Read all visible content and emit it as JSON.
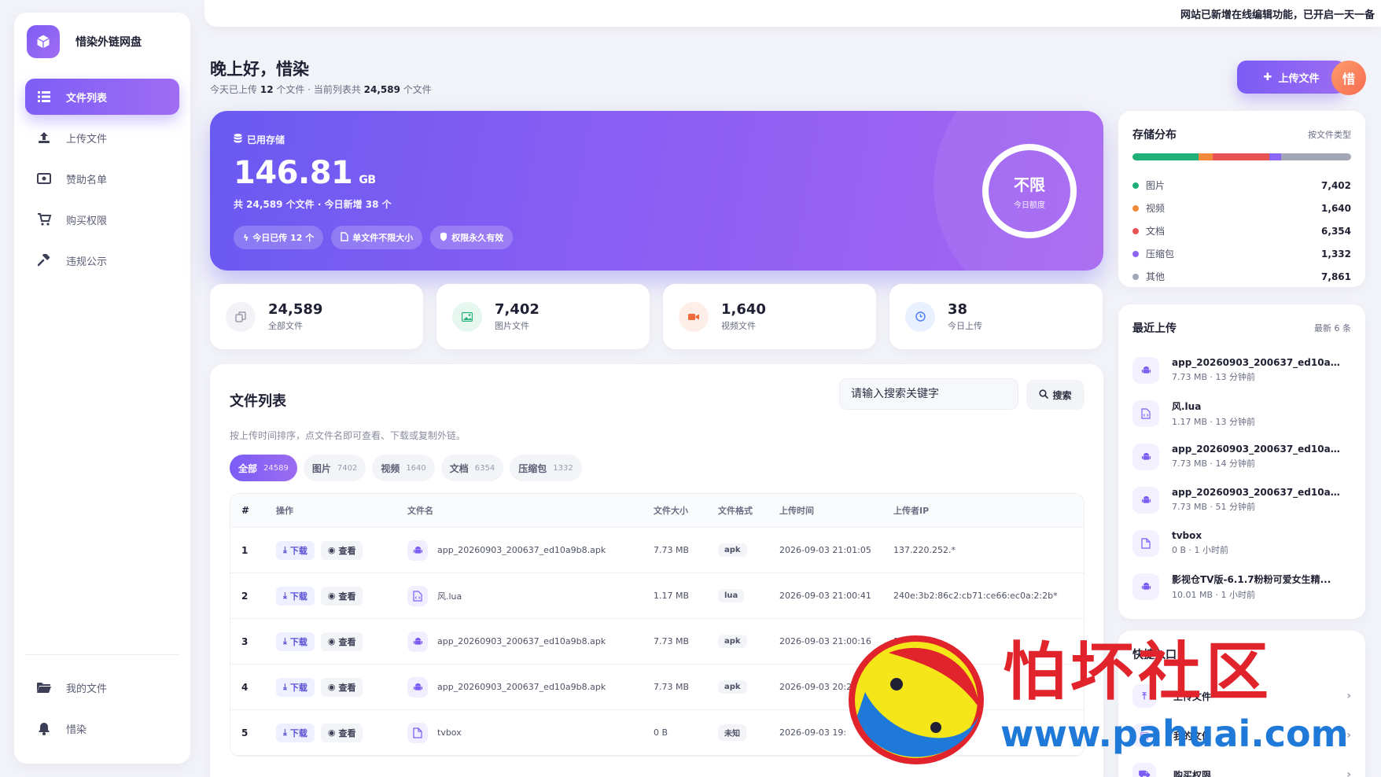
{
  "brand": {
    "name": "惜染外链网盘"
  },
  "sidebar": {
    "items": [
      {
        "label": "文件列表",
        "icon": "list-icon",
        "active": true
      },
      {
        "label": "上传文件",
        "icon": "upload-icon"
      },
      {
        "label": "赞助名单",
        "icon": "money-icon"
      },
      {
        "label": "购买权限",
        "icon": "cart-icon"
      },
      {
        "label": "违规公示",
        "icon": "gavel-icon"
      }
    ],
    "bottom_items": [
      {
        "label": "我的文件",
        "icon": "folder-icon"
      },
      {
        "label": "惜染",
        "icon": "bell-icon"
      }
    ]
  },
  "notice": {
    "text": "网站已新增在线编辑功能，已开启一天一备"
  },
  "greeting": {
    "title": "晚上好，惜染",
    "sub_prefix": "今天已上传",
    "today_count": "12",
    "sub_middle": "个文件 · 当前列表共",
    "list_count": "24,589",
    "sub_suffix": "个文件"
  },
  "header": {
    "upload_label": "上传文件",
    "avatar_text": "惜"
  },
  "storage": {
    "label": "已用存储",
    "value": "146.81",
    "unit": "GB",
    "sub": "共 24,589 个文件 · 今日新增 38 个",
    "pills": [
      "今日已传 12 个",
      "单文件不限大小",
      "权限永久有效"
    ],
    "quota_big": "不限",
    "quota_small": "今日额度"
  },
  "stats": [
    {
      "value": "24,589",
      "label": "全部文件",
      "icon": "copy-icon",
      "bg": "#f2f2f7",
      "fg": "#9a9cae"
    },
    {
      "value": "7,402",
      "label": "图片文件",
      "icon": "image-icon",
      "bg": "#e6f7ef",
      "fg": "#22b07d"
    },
    {
      "value": "1,640",
      "label": "视频文件",
      "icon": "video-icon",
      "bg": "#fdeee8",
      "fg": "#f26b3a"
    },
    {
      "value": "38",
      "label": "今日上传",
      "icon": "clock-icon",
      "bg": "#e9f0ff",
      "fg": "#4b7bf5"
    }
  ],
  "file_list": {
    "title": "文件列表",
    "search_placeholder": "请输入搜索关键字",
    "search_label": "搜索",
    "hint": "按上传时间排序，点文件名即可查看、下载或复制外链。",
    "tabs": [
      {
        "label": "全部",
        "count": "24589",
        "active": true
      },
      {
        "label": "图片",
        "count": "7402"
      },
      {
        "label": "视频",
        "count": "1640"
      },
      {
        "label": "文档",
        "count": "6354"
      },
      {
        "label": "压缩包",
        "count": "1332"
      }
    ],
    "columns": [
      "#",
      "操作",
      "文件名",
      "文件大小",
      "文件格式",
      "上传时间",
      "上传者IP"
    ],
    "download_label": "下载",
    "view_label": "查看",
    "rows": [
      {
        "no": "1",
        "name": "app_20260903_200637_ed10a9b8.apk",
        "icon": "android-icon",
        "size": "7.73 MB",
        "fmt": "apk",
        "time": "2026-09-03 21:01:05",
        "ip": "137.220.252.*"
      },
      {
        "no": "2",
        "name": "风.lua",
        "icon": "code-file-icon",
        "size": "1.17 MB",
        "fmt": "lua",
        "time": "2026-09-03 21:00:41",
        "ip": "240e:3b2:86c2:cb71:ce66:ec0a:2:2b*"
      },
      {
        "no": "3",
        "name": "app_20260903_200637_ed10a9b8.apk",
        "icon": "android-icon",
        "size": "7.73 MB",
        "fmt": "apk",
        "time": "2026-09-03 21:00:16",
        "ip": "137"
      },
      {
        "no": "4",
        "name": "app_20260903_200637_ed10a9b8.apk",
        "icon": "android-icon",
        "size": "7.73 MB",
        "fmt": "apk",
        "time": "2026-09-03 20:2",
        "ip": ""
      },
      {
        "no": "5",
        "name": "tvbox",
        "icon": "file-icon",
        "size": "0 B",
        "fmt": "未知",
        "time": "2026-09-03 19:",
        "ip": ""
      }
    ]
  },
  "distribution": {
    "title": "存储分布",
    "meta": "按文件类型",
    "items": [
      {
        "label": "图片",
        "value": "7,402",
        "num": 7402,
        "color": "#1fb07a"
      },
      {
        "label": "视频",
        "value": "1,640",
        "num": 1640,
        "color": "#f28a3a"
      },
      {
        "label": "文档",
        "value": "6,354",
        "num": 6354,
        "color": "#e85454"
      },
      {
        "label": "压缩包",
        "value": "1,332",
        "num": 1332,
        "color": "#8b65f3"
      },
      {
        "label": "其他",
        "value": "7,861",
        "num": 7861,
        "color": "#a3a6b4"
      }
    ]
  },
  "recent": {
    "title": "最近上传",
    "meta": "最新 6 条",
    "items": [
      {
        "name": "app_20260903_200637_ed10a9b8...",
        "meta": "7.73 MB · 13 分钟前",
        "icon": "android-icon"
      },
      {
        "name": "风.lua",
        "meta": "1.17 MB · 13 分钟前",
        "icon": "code-file-icon"
      },
      {
        "name": "app_20260903_200637_ed10a9b8...",
        "meta": "7.73 MB · 14 分钟前",
        "icon": "android-icon"
      },
      {
        "name": "app_20260903_200637_ed10a9b8...",
        "meta": "7.73 MB · 51 分钟前",
        "icon": "android-icon"
      },
      {
        "name": "tvbox",
        "meta": "0 B · 1 小时前",
        "icon": "file-icon"
      },
      {
        "name": "影视仓TV版-6.1.7粉粉可爱女生精...",
        "meta": "10.01 MB · 1 小时前",
        "icon": "android-icon"
      }
    ]
  },
  "quick": {
    "title": "快捷入口",
    "items": [
      {
        "label": "上传文件"
      },
      {
        "label": "我的文件"
      },
      {
        "label": "购买权限"
      }
    ]
  },
  "watermark": {
    "main": "怕坏社区",
    "url": "www.pahuai.com"
  }
}
